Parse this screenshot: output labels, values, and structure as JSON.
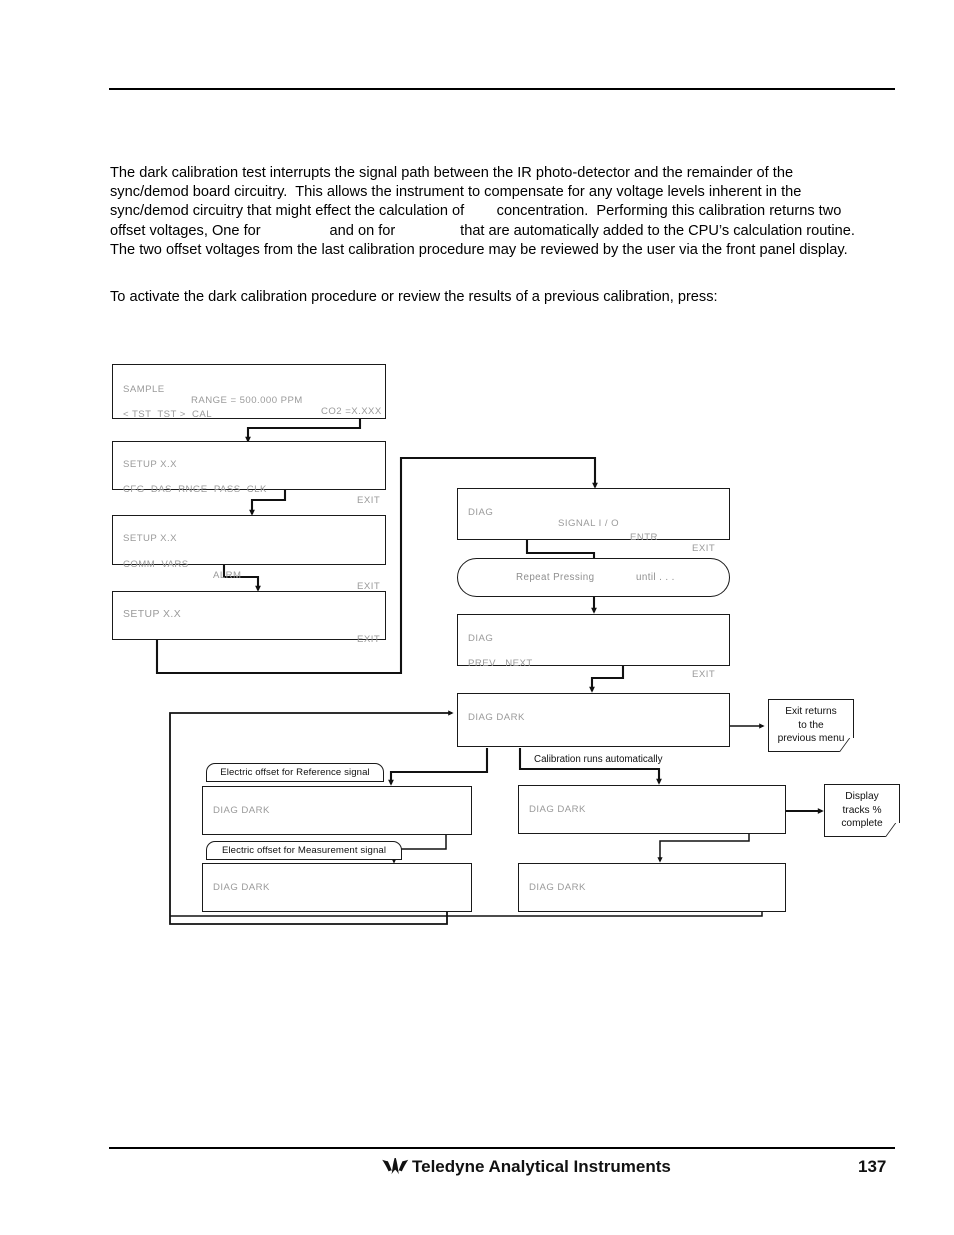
{
  "page": {
    "number": "137",
    "footer_title": "Teledyne Analytical Instruments",
    "logo_name": "teledyne-bird-logo"
  },
  "body": {
    "paragraph_1": "The dark calibration test interrupts the signal path between the IR photo-detector and the remainder of the sync/demod board circuitry.  This allows the instrument to compensate for any voltage levels inherent in the sync/demod circuitry that might effect the calculation of        concentration.  Performing this calibration returns two offset voltages, One for                 and on for                that are automatically added to the CPU’s calculation routine.  The two offset voltages from the last calibration procedure may be reviewed by the user via the front panel display.",
    "paragraph_2": "To activate the dark calibration procedure or review the results of a previous calibration, press:"
  },
  "diagram": {
    "displays": [
      {
        "id": "sample-display",
        "line1_left": "SAMPLE",
        "line1_mid": "RANGE = 500.000 PPM",
        "line1_right": "CO2 =X.XXX",
        "line2_left": "< TST  TST >  CAL"
      },
      {
        "id": "setup-cfg-display",
        "line1_left": "SETUP X.X",
        "line2_left": "CFG  DAS  RNGE  PASS  CLK",
        "line2_right": "EXIT"
      },
      {
        "id": "setup-comm-display",
        "line1_left": "SETUP X.X",
        "line2_left": "COMM  VARS",
        "line2_mid": "ALRM",
        "line2_right": "EXIT"
      },
      {
        "id": "setup-diag-display",
        "line1_left": "SETUP X.X",
        "line2_right": "EXIT"
      },
      {
        "id": "diag-signal-io-display",
        "line1_left": "DIAG",
        "line1_mid": "SIGNAL I / O",
        "line2_entr": "ENTR",
        "line2_right": "EXIT"
      },
      {
        "id": "diag-prev-next-display",
        "line1_left": "DIAG",
        "line2_left": "PREV   NEXT",
        "line2_right": "EXIT"
      },
      {
        "id": "diag-dark-start-display",
        "line1_left": "DIAG DARK"
      },
      {
        "id": "diag-dark-reference-display",
        "line1_left": "DIAG DARK"
      },
      {
        "id": "diag-dark-measurement-display",
        "line1_left": "DIAG DARK"
      },
      {
        "id": "diag-dark-running-1-display",
        "line1_left": "DIAG DARK"
      },
      {
        "id": "diag-dark-running-2-display",
        "line1_left": "DIAG DARK"
      }
    ],
    "repeat_pill": {
      "text_left": "Repeat Pressing",
      "text_right": "until . . ."
    },
    "caption_tabs": [
      {
        "id": "reference-offset-tab",
        "label": "Electric offset for Reference signal"
      },
      {
        "id": "measurement-offset-tab",
        "label": "Electric offset for Measurement signal"
      }
    ],
    "captions": [
      {
        "id": "calibration-auto-caption",
        "label": "Calibration runs automatically"
      }
    ],
    "notes": [
      {
        "id": "exit-returns-note",
        "label": "Exit returns\nto the\nprevious menu"
      },
      {
        "id": "display-tracks-note",
        "label": "Display\ntracks %\ncomplete"
      }
    ]
  },
  "colors": {
    "lcd_text": "#9a9a9a",
    "ink": "#111111",
    "border": "#1a1a1a"
  }
}
